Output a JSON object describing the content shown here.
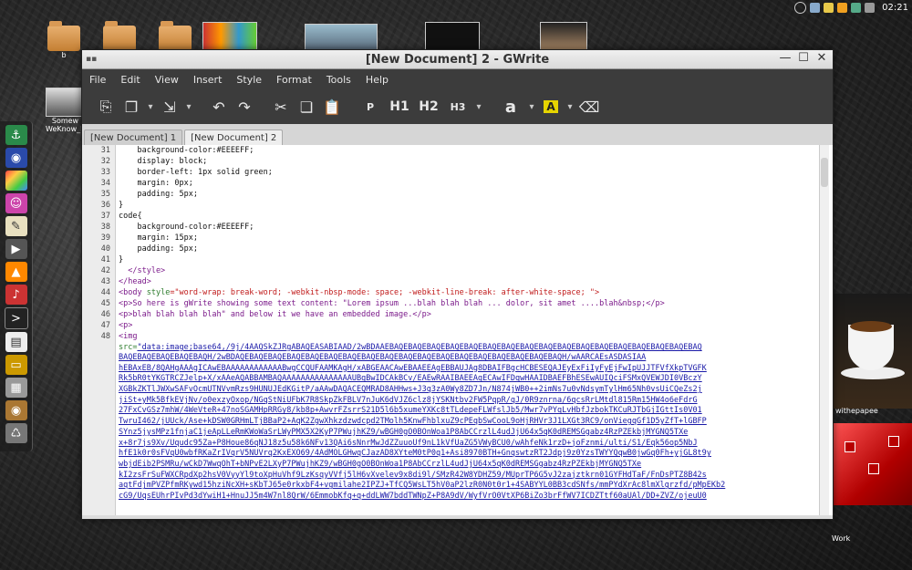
{
  "window": {
    "title": "[New Document] 2 - GWrite"
  },
  "menu": [
    "File",
    "Edit",
    "View",
    "Insert",
    "Style",
    "Format",
    "Tools",
    "Help"
  ],
  "toolbar": {
    "icons": [
      "new-tab-icon",
      "copy-document-icon",
      "dropdown-icon",
      "export-icon",
      "dropdown-icon",
      "undo-icon",
      "redo-icon",
      "cut-icon",
      "copy-icon",
      "paste-icon"
    ],
    "paragraph": "P",
    "h1": "H1",
    "h2": "H2",
    "h3": "H3",
    "font": "a",
    "highlight": "A"
  },
  "tabs": [
    {
      "label": "[New Document] 1",
      "active": false
    },
    {
      "label": "[New Document] 2",
      "active": true
    }
  ],
  "tray": {
    "clock": "02:21"
  },
  "desktop": {
    "folder_b_label": "b",
    "some_label": "Somew",
    "weknow_label": "WeKnow_P",
    "withepapee_label": "withepapee",
    "work_label": "Work"
  },
  "editor": {
    "line_numbers": [
      "31",
      "32",
      "33",
      "34",
      "35",
      "36",
      "37",
      "38",
      "39",
      "40",
      "41",
      "42",
      "43",
      "44",
      "45",
      "46",
      "47",
      "48"
    ],
    "lines": [
      "    background-color:#EEEEFF;",
      "    display: block;",
      "    border-left: 1px solid green;",
      "    margin: 0px;",
      "    padding: 5px;",
      "}",
      "code{",
      "    background-color:#EEEEFF;",
      "    margin: 15px;",
      "    padding: 5px;",
      "}",
      "  </style>",
      "</head>"
    ],
    "body_tag_open": "<body ",
    "body_style_attr": "style",
    "body_style_val": "=\"word-wrap: break-word; -webkit-nbsp-mode: space; -webkit-line-break: after-white-space; \">",
    "line45": "<p>So here is gWrite showing some text content: \"Lorem ipsum ...blah blah blah ... dolor, sit amet ....blah&nbsp;</p>",
    "line46": "<p>blah blah blah blah\" and below it we have an embedded image.</p>",
    "line47": "<p>",
    "line48": "<img",
    "src_attr": "src=",
    "base64": [
      "\"data:image;base64,/9j/4AAQSkZJRgABAQEASABIAAD/2wBDAAEBAQEBAQEBAQEBAQEBAQEBAQEBAQEBAQEBAQEBAQEBAQEBAQEBAQEBAQEBAQEBAQEBAQ",
      "BAQEBAQEBAQEBAQEBAQH/2wBDAQEBAQEBAQEBAQEBAQEBAQEBAQEBAQEBAQEBAQEBAQEBAQEBAQEBAQEBAQEBAQEBAQEBAQH/wAARCAEsASDASIAA",
      "hEBAxEB/8QAHgAAAgICAwEBAAAAAAAAAAAABwgCCQUFAAMKAgH/xABGEAACAwEBAAEEAgEBBAUJAg8DBAIFBgcHCBESEQAJEyExFiIyFyEjFwIpUJJTFVfXkpTVGFK",
      "Rk5bR0tYKGTRCZJelp+X/xAAeAQABBAMBAQAAAAAAAAAAAAAAAUBgBwIDCAkBCv/EAEwRAAIBAEEAgECAwIFDqwHAAIDBAEFBhESEwAUIQciFSMxQVEWJDI0VBczY",
      "XGBkZKTlJWXwSAFvOcmUTNVvmRzs9HUNUJEdKGitP/aAAwDAQACEQMRAD8AHHws+J3q3zA0Wy8ZD7Jn/N874jWB0++2imNs7u0vNdsymTylHm65Nh0vsUiCQeZs2j",
      "jiSt+yMk5BfkEVjNv/o0exzyOxop/NGqStNiUFbK7R8SkpZkFBLV7nJuK6dVJZ6clz8jYSKNtbv2FW5PqpR/qJ/0R9znrna/6qcsRrLMtdl815Rm15HW4o6eFdrG",
      "27FxCvGSz7mhW/4WeVteR+47noSGAMHpRRGy8/kb8p+AwvrFZsrrS21D5l6b5xumeYXKc8tTLdepeFLWfslJb5/Mwr7vPYqLvHbfJzbokTKCuRJTbGjIGttIs0V01",
      "TwruI462/jUUck/Ase+kDSW0GRHmLTjBBaP2+AqK2ZgwXhkzdzwdcpd2TMolh5KnwFhblxuZ9cPEqbSwCooL9oHjRHVr3J1LXGt3RC9/onViegqGf1D5yZfT+lGBFP",
      "SYnz5jysMPz1fnjaC1jeApLLeRmKWoWaSrLWyPMX5X2KyP7PWujhKZ9/wBGH0gO0BOnWoa1P8AbCCrzlL4udJjU64x5qK0dREMSGgabz4RzPZEkbjMYGNQ5TXe",
      "x+8r7js9Xv/Uqudc95Za+P8Houe86qNJ18z5u58k6NFv13QAi6sNnrMwJdZZuuoUf9nL1kVfUaZG5VWyBCU0/wAhfeNk1rzD+joFznmi/ulti/S1/Eqk56op5NbJ",
      "hfE1k0r0sFVqU0wbfRKaZrIVqrV5NUVrq2KxEXO69/4AdMOLGHwqCJazAD8XYteM0tP0q1+Asi8970BTH+GnqswtzRT2Jdpj9z0YzsTWYYQqwB0jwGq0Fh+yjGL8t9y",
      "wbjdEib2PSMRu/wCkD7WwqOhT+bNPvE2LXyP7PWujhKZ9/wBGH0gO0BOnWoa1P8AbCCrzlL4udJjU64x5qK0dREMSGgabz4RzPZEkbjMYGNQ5TXe",
      "kI2zsFrSuFWXCRpdXp2hsV0VyyYl9toXpHuVhf9LzKsqyVVfj5lH6vXvelev9x8di9l/SMzR42W8YDHZ59/MUprTP6G5vJ2zajztkrn01GYFHdTaF/FnDsPTZ8B42s",
      "aqtFdjmPVZPfmRKywd15hziNcXH+sKbTJ65e0rkxbF4+vgmilahe2IPZJ+TfCQ5WsLT5hV0aP2lzR0N0t0r1+4SABYYL0BB3cdSNfs/mmPYdXrAc8lmXlgrzfd/pMpEKb2",
      "cG9/UqsEUhrPIvPd3dYwiH1+HnuJJ5m4W7nl8QrW/6EmmobKfq+q+ddLWW7bddTWNpZ+P8A9dV/WyfVrO0VtXP6BiZo3brFfWV7ICDZTtf60aUAl/DD+ZVZ/ojeuU0"
    ]
  }
}
